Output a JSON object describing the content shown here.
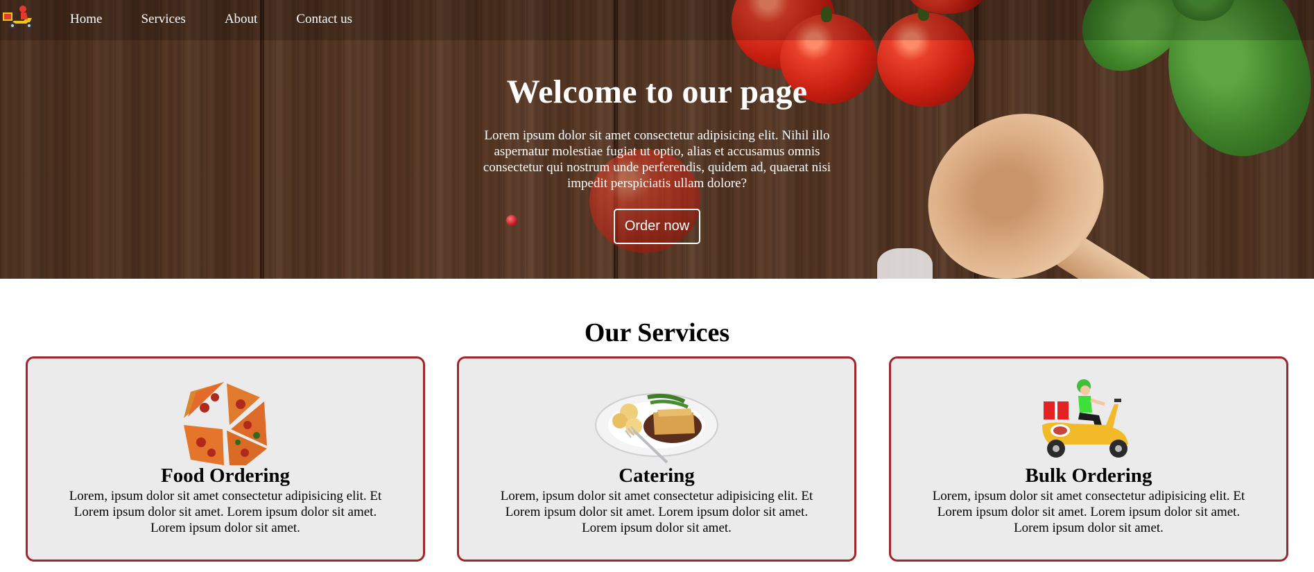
{
  "nav": {
    "logo_icon": "delivery-scooter-icon",
    "links": [
      {
        "label": "Home"
      },
      {
        "label": "Services"
      },
      {
        "label": "About"
      },
      {
        "label": "Contact us"
      }
    ]
  },
  "hero": {
    "title": "Welcome to our page",
    "text": "Lorem ipsum dolor sit amet consectetur adipisicing elit. Nihil illo aspernatur molestiae fugiat ut optio, alias et accusamus omnis consectetur qui nostrum unde perferendis, quidem ad, quaerat nisi impedit perspiciatis ullam dolore?",
    "button_label": "Order now"
  },
  "services": {
    "title": "Our Services",
    "cards": [
      {
        "icon": "pizza-slices-image",
        "title": "Food Ordering",
        "text": "Lorem, ipsum dolor sit amet consectetur adipisicing elit. Et Lorem ipsum dolor sit amet. Lorem ipsum dolor sit amet. Lorem ipsum dolor sit amet."
      },
      {
        "icon": "catering-plate-image",
        "title": "Catering",
        "text": "Lorem, ipsum dolor sit amet consectetur adipisicing elit. Et Lorem ipsum dolor sit amet. Lorem ipsum dolor sit amet. Lorem ipsum dolor sit amet."
      },
      {
        "icon": "delivery-scooter-image",
        "title": "Bulk Ordering",
        "text": "Lorem, ipsum dolor sit amet consectetur adipisicing elit. Et Lorem ipsum dolor sit amet. Lorem ipsum dolor sit amet. Lorem ipsum dolor sit amet."
      }
    ]
  },
  "colors": {
    "card_border": "#a0262b",
    "card_background": "#ebebeb",
    "hero_wood": "#5b3a26",
    "hero_text": "#ffffff"
  }
}
